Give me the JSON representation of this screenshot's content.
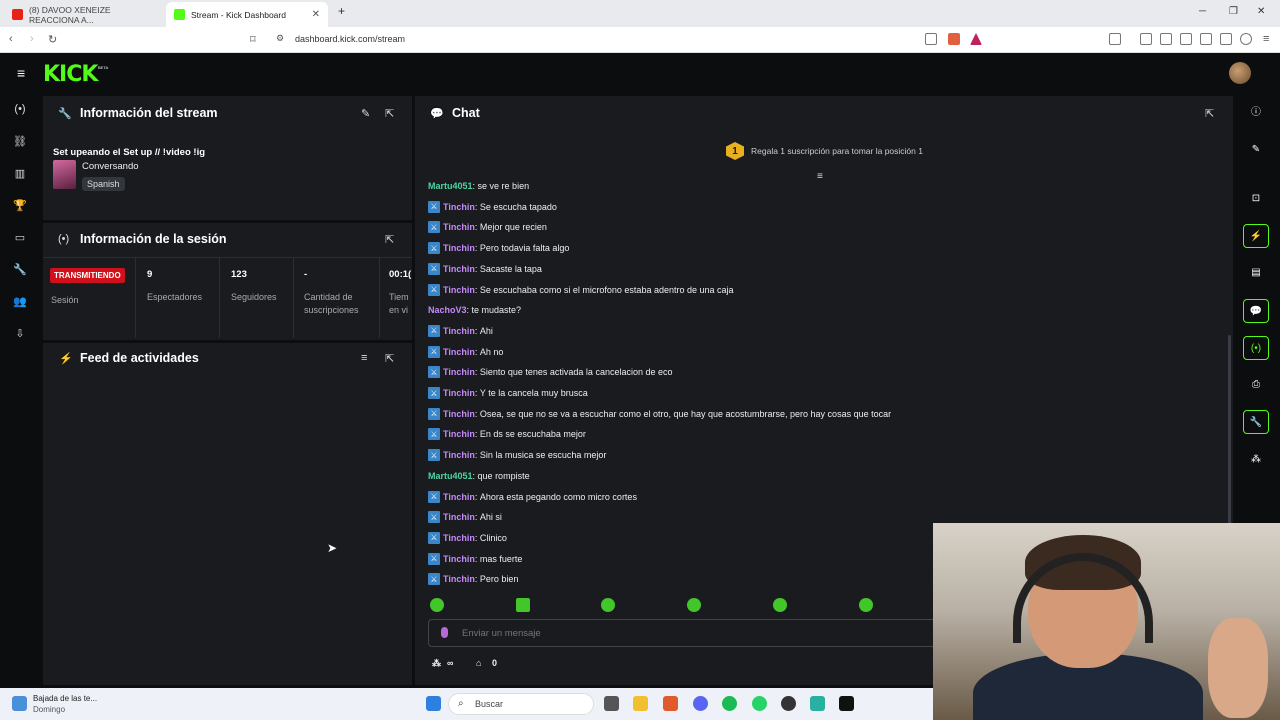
{
  "browser": {
    "tabs": [
      {
        "title": "(8) DAVOO XENEIZE REACCIONA A...",
        "active": false
      },
      {
        "title": "Stream - Kick Dashboard",
        "active": true
      }
    ],
    "url": "dashboard.kick.com/stream"
  },
  "header": {
    "logo": "KICK",
    "logo_badge": "BETA"
  },
  "stream_info": {
    "title": "Información del stream",
    "stream_title": "Set upeando el Set up // !video !ig",
    "category": "Conversando",
    "language": "Spanish"
  },
  "session": {
    "title": "Información de la sesión",
    "status": "TRANSMITIENDO",
    "session_label": "Sesión",
    "stats": [
      {
        "value": "9",
        "label": "Espectadores"
      },
      {
        "value": "123",
        "label": "Seguidores"
      },
      {
        "value": "-",
        "label": "Cantidad de suscripciones"
      },
      {
        "value": "00:1(",
        "label": "Tiem en vi"
      }
    ]
  },
  "activity": {
    "title": "Feed de actividades"
  },
  "chat": {
    "title": "Chat",
    "promo": "Regala 1 suscripción para tomar la posición 1",
    "promo_rank": "1",
    "messages": [
      {
        "user": "Martu4051",
        "text": "se ve re bien",
        "color": "#4fd4a0",
        "badge": false
      },
      {
        "user": "Tinchin",
        "text": "Se escucha tapado",
        "color": "#c58af9",
        "badge": true
      },
      {
        "user": "Tinchin",
        "text": "Mejor que recien",
        "color": "#c58af9",
        "badge": true
      },
      {
        "user": "Tinchin",
        "text": "Pero todavia falta algo",
        "color": "#c58af9",
        "badge": true
      },
      {
        "user": "Tinchin",
        "text": "Sacaste la tapa",
        "color": "#c58af9",
        "badge": true
      },
      {
        "user": "Tinchin",
        "text": "Se escuchaba como si el microfono estaba adentro de una caja",
        "color": "#c58af9",
        "badge": true
      },
      {
        "user": "NachoV3",
        "text": "te mudaste?",
        "color": "#c58af9",
        "badge": false
      },
      {
        "user": "Tinchin",
        "text": "Ahi",
        "color": "#c58af9",
        "badge": true
      },
      {
        "user": "Tinchin",
        "text": "Ah no",
        "color": "#c58af9",
        "badge": true
      },
      {
        "user": "Tinchin",
        "text": "Siento que tenes activada la cancelacion de eco",
        "color": "#c58af9",
        "badge": true
      },
      {
        "user": "Tinchin",
        "text": "Y te la cancela muy brusca",
        "color": "#c58af9",
        "badge": true
      },
      {
        "user": "Tinchin",
        "text": "Osea, se que no se va a escuchar como el otro, que hay que acostumbrarse, pero hay cosas que tocar",
        "color": "#c58af9",
        "badge": true
      },
      {
        "user": "Tinchin",
        "text": "En ds se escuchaba mejor",
        "color": "#c58af9",
        "badge": true
      },
      {
        "user": "Tinchin",
        "text": "Sin la musica se escucha mejor",
        "color": "#c58af9",
        "badge": true
      },
      {
        "user": "Martu4051",
        "text": "que rompiste",
        "color": "#4fd4a0",
        "badge": false
      },
      {
        "user": "Tinchin",
        "text": "Ahora esta pegando como micro cortes",
        "color": "#c58af9",
        "badge": true
      },
      {
        "user": "Tinchin",
        "text": "Ahi si",
        "color": "#c58af9",
        "badge": true
      },
      {
        "user": "Tinchin",
        "text": "Clinico",
        "color": "#c58af9",
        "badge": true
      },
      {
        "user": "Tinchin",
        "text": "mas fuerte",
        "color": "#c58af9",
        "badge": true
      },
      {
        "user": "Tinchin",
        "text": "Pero bien",
        "color": "#c58af9",
        "badge": true
      }
    ],
    "input_placeholder": "Enviar un mensaje",
    "footer_left": "∞",
    "footer_count": "0"
  },
  "taskbar": {
    "weather_line1": "Bajada de las te...",
    "weather_line2": "Domingo",
    "search": "Buscar"
  },
  "colors": {
    "accent": "#53fc18",
    "live": "#d0101a",
    "panel": "#191b1f",
    "bg": "#0b0d0e"
  }
}
